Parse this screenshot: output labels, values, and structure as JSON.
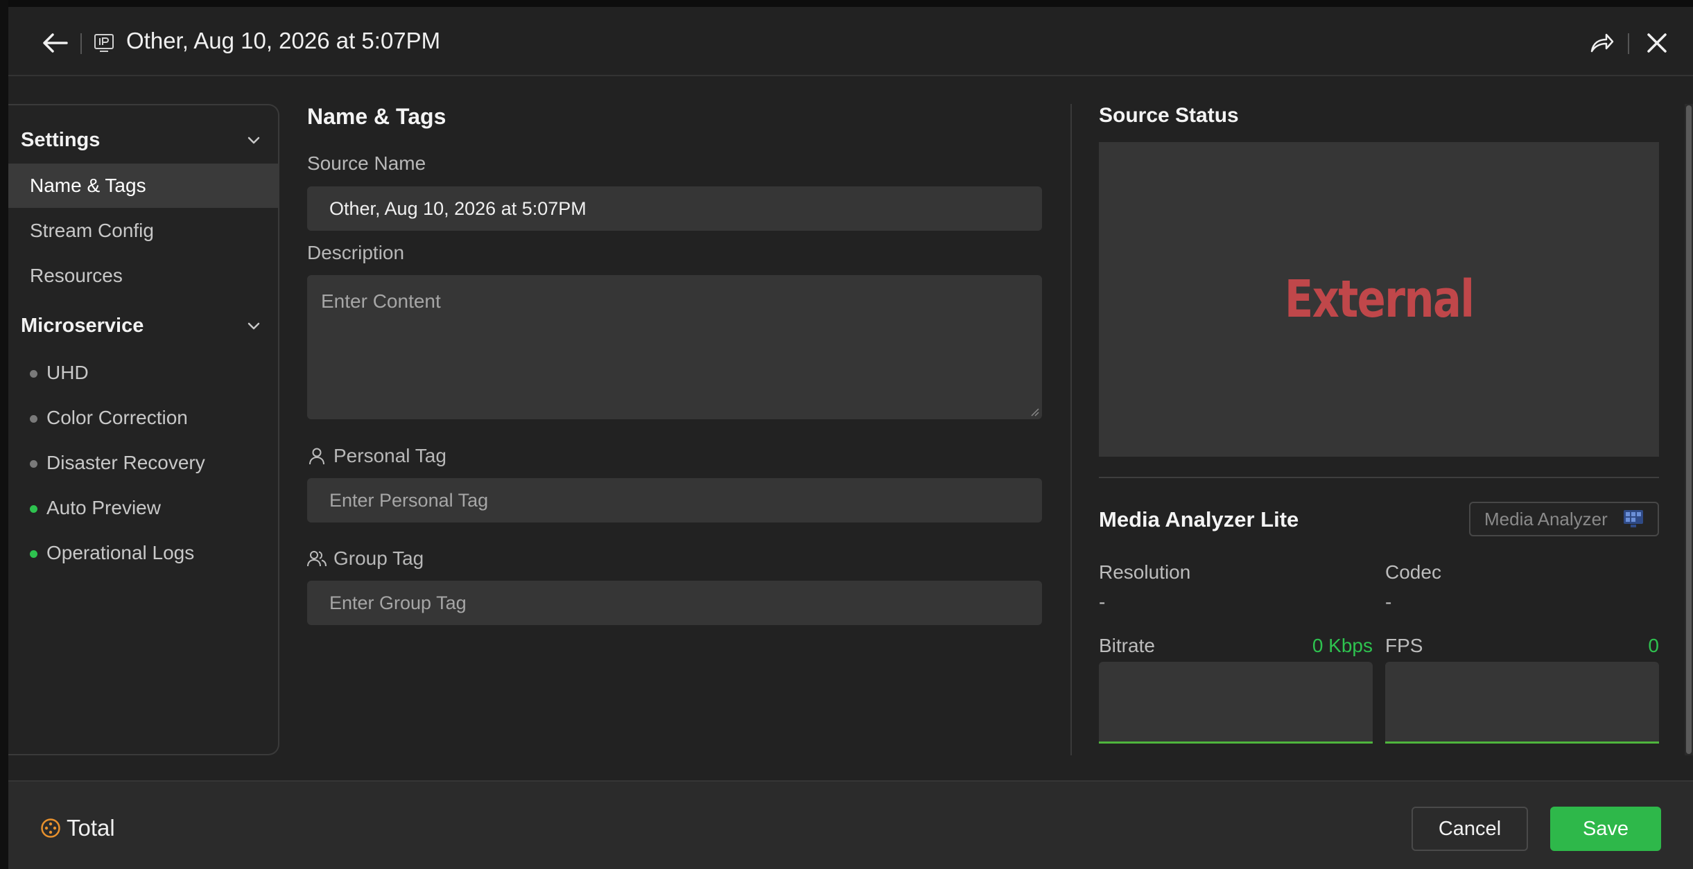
{
  "header": {
    "title": "Other, Aug 10, 2026 at 5:07PM",
    "back_icon": "arrow-left-icon",
    "source_type_icon": "ip-source-icon",
    "share_icon": "share-icon",
    "close_icon": "close-icon"
  },
  "sidebar": {
    "sections": [
      {
        "label": "Settings",
        "items": [
          "Name & Tags",
          "Stream Config",
          "Resources"
        ]
      },
      {
        "label": "Microservice",
        "items": [
          {
            "label": "UHD",
            "status": "inactive"
          },
          {
            "label": "Color Correction",
            "status": "inactive"
          },
          {
            "label": "Disaster Recovery",
            "status": "inactive"
          },
          {
            "label": "Auto Preview",
            "status": "active"
          },
          {
            "label": "Operational Logs",
            "status": "active"
          }
        ]
      }
    ],
    "active_item": "Name & Tags"
  },
  "form": {
    "title": "Name & Tags",
    "source_name_label": "Source Name",
    "source_name_value": "Other, Aug 10, 2026 at 5:07PM",
    "description_label": "Description",
    "description_placeholder": "Enter Content",
    "personal_tag_label": "Personal Tag",
    "personal_tag_placeholder": "Enter Personal Tag",
    "group_tag_label": "Group Tag",
    "group_tag_placeholder": "Enter Group Tag"
  },
  "source_status": {
    "title": "Source Status",
    "preview_text": "External"
  },
  "media_analyzer": {
    "title": "Media Analyzer Lite",
    "button_label": "Media Analyzer",
    "resolution_label": "Resolution",
    "resolution_value": "-",
    "codec_label": "Codec",
    "codec_value": "-",
    "bitrate_label": "Bitrate",
    "bitrate_value": "0 Kbps",
    "fps_label": "FPS",
    "fps_value": "0"
  },
  "footer": {
    "total_label": "Total",
    "cancel_label": "Cancel",
    "save_label": "Save"
  },
  "colors": {
    "accent_green": "#2eb84a",
    "preview_text_red": "#c0474a",
    "footer_icon_orange": "#e8912d",
    "background": "#222222"
  }
}
